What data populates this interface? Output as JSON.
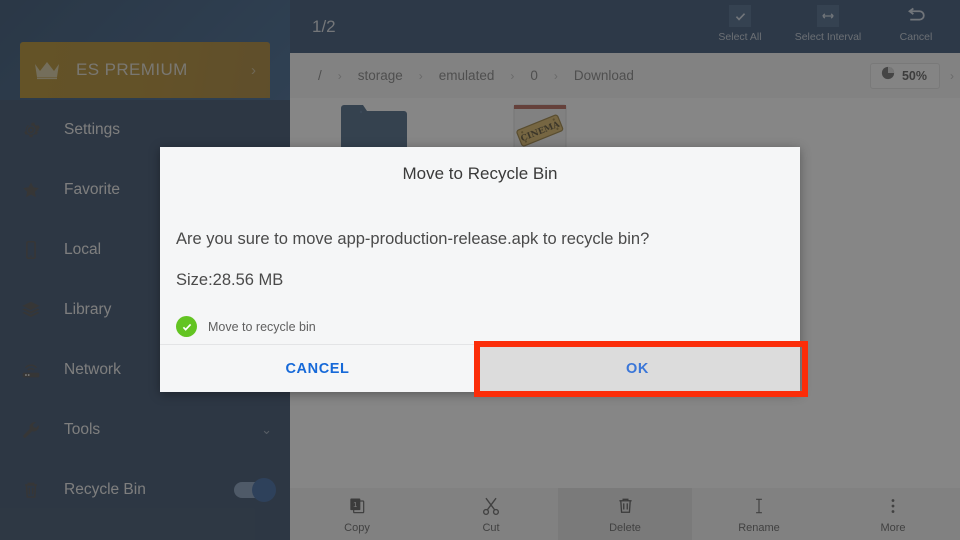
{
  "drawer": {
    "premium": {
      "label": "ES PREMIUM",
      "icon": "crown-icon",
      "chevron": "›"
    },
    "items": [
      {
        "label": "Settings",
        "icon": "gear-icon"
      },
      {
        "label": "Favorite",
        "icon": "star-icon"
      },
      {
        "label": "Local",
        "icon": "phone-icon"
      },
      {
        "label": "Library",
        "icon": "layers-icon"
      },
      {
        "label": "Network",
        "icon": "router-icon"
      },
      {
        "label": "Tools",
        "icon": "wrench-icon",
        "chevron": "⌄"
      },
      {
        "label": "Recycle Bin",
        "icon": "trash-icon",
        "toggle": "on"
      }
    ]
  },
  "topbar": {
    "selection_count": "1/2",
    "actions": [
      {
        "label": "Select All",
        "icon": "checkbox-checked-icon"
      },
      {
        "label": "Select Interval",
        "icon": "interval-icon"
      },
      {
        "label": "Cancel",
        "icon": "undo-arrow-icon"
      }
    ]
  },
  "breadcrumb": {
    "separator": "›",
    "items": [
      "/",
      "storage",
      "emulated",
      "0",
      "Download"
    ],
    "storage": {
      "percent": "50%",
      "icon": "pie-chart-icon",
      "chevron": "›"
    }
  },
  "files": [
    {
      "name": "folder",
      "icon": "folder-icon"
    },
    {
      "name": "apk",
      "icon": "cinema-ticket-icon"
    }
  ],
  "bottombar": {
    "items": [
      {
        "label": "Copy",
        "icon": "copy-icon",
        "active": false
      },
      {
        "label": "Cut",
        "icon": "scissors-icon",
        "active": false
      },
      {
        "label": "Delete",
        "icon": "trash-icon",
        "active": true
      },
      {
        "label": "Rename",
        "icon": "text-cursor-icon",
        "active": false
      },
      {
        "label": "More",
        "icon": "overflow-dots-icon",
        "active": false
      }
    ]
  },
  "dialog": {
    "title": "Move to Recycle Bin",
    "message": "Are you sure to move app-production-release.apk to recycle bin?",
    "size": "Size:28.56 MB",
    "checkbox_label": "Move to recycle bin",
    "checkbox_state": "checked",
    "cancel_label": "CANCEL",
    "ok_label": "OK"
  },
  "colors": {
    "accent_blue": "#16365c",
    "premium_gold": "#a57a06",
    "link_blue": "#1669d8",
    "check_green": "#63c422",
    "highlight_red": "#fb2d09",
    "toggle_on": "#1a4b8f"
  }
}
